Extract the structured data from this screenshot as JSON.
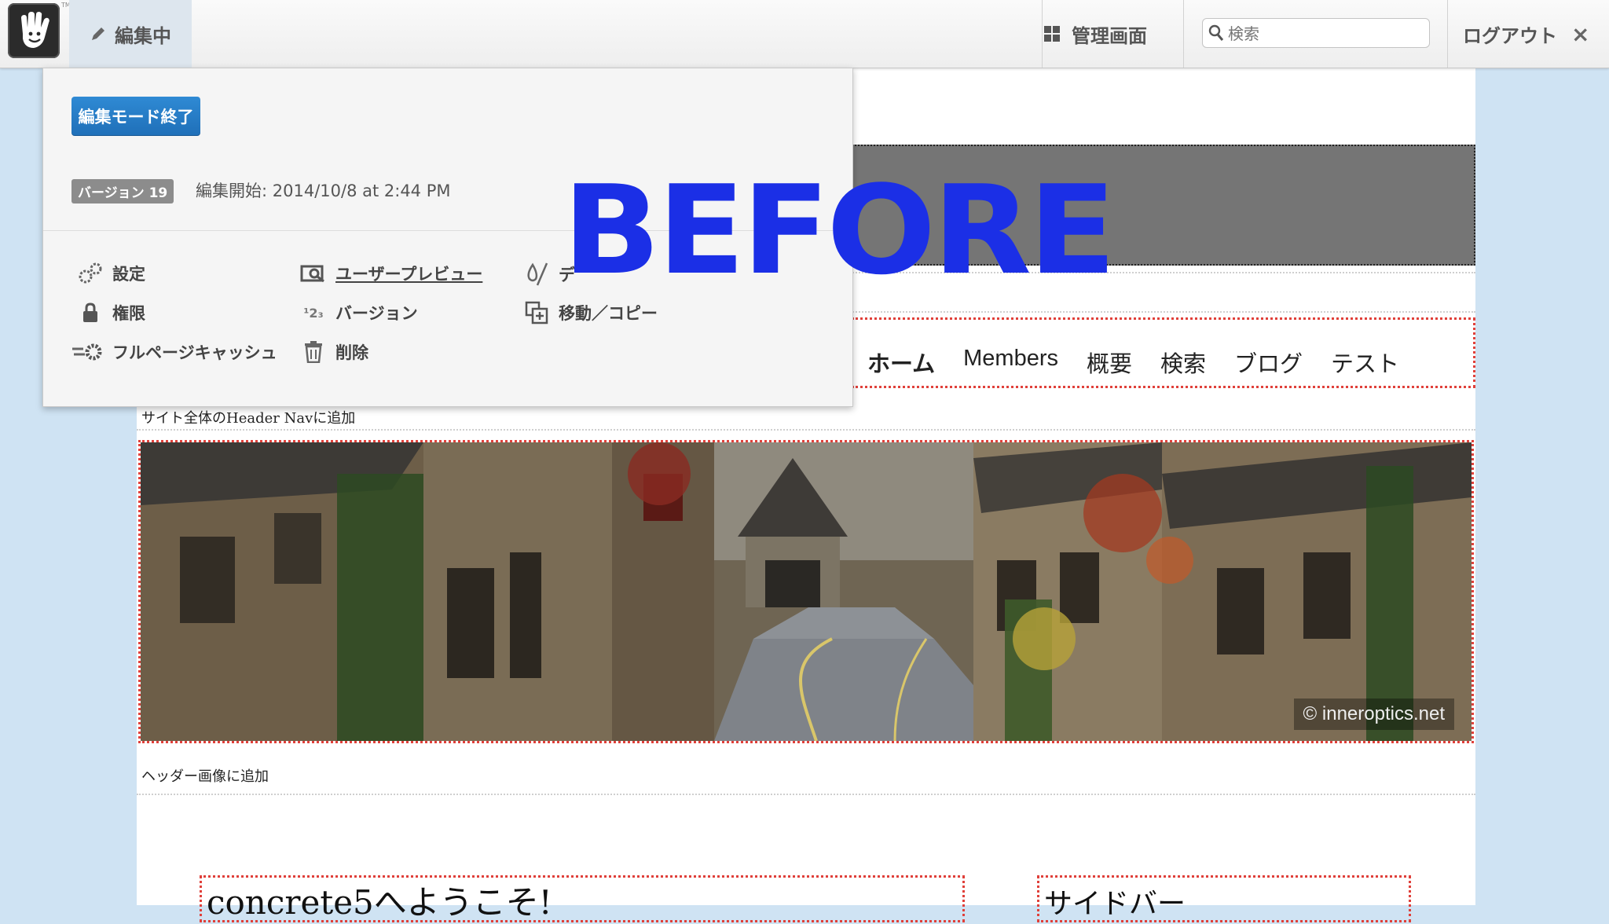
{
  "toolbar": {
    "edit_label": "編集中",
    "admin_label": "管理画面",
    "search_placeholder": "検索",
    "logout_label": "ログアウト",
    "logout_close": "×"
  },
  "edit_panel": {
    "exit_button": "編集モード終了",
    "version_badge": "バージョン 19",
    "version_info": "編集開始: 2014/10/8 at 2:44 PM",
    "items": [
      {
        "label": "設定",
        "icon": "settings-icon"
      },
      {
        "label": "権限",
        "icon": "lock-icon"
      },
      {
        "label": "フルページキャッシュ",
        "icon": "cache-gear-icon"
      },
      {
        "label": "ユーザープレビュー",
        "icon": "preview-icon"
      },
      {
        "label": "バージョン",
        "icon": "versions-icon"
      },
      {
        "label": "削除",
        "icon": "trash-icon"
      },
      {
        "label": "デ",
        "icon": "design-icon"
      },
      {
        "label": "移動／コピー",
        "icon": "move-copy-icon"
      }
    ]
  },
  "watermark": "BEFORE",
  "site": {
    "nav": [
      "ホーム",
      "Members",
      "概要",
      "検索",
      "ブログ",
      "テスト"
    ],
    "header_nav_add": "サイト全体のHeader Navに追加",
    "header_image_add": "ヘッダー画像に追加",
    "image_credit": "© inneroptics.net",
    "main_heading": "concrete5へようこそ!",
    "sidebar_heading": "サイドバー"
  },
  "colors": {
    "accent_blue": "#1f6fb8",
    "watermark_blue": "#1b2fe6",
    "block_outline_red": "#e0403a"
  }
}
